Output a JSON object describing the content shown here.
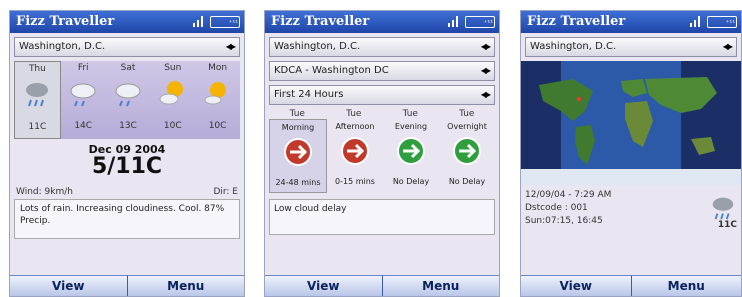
{
  "app": {
    "title": "Fizz Traveller",
    "battery": "⁺¹¹"
  },
  "softkeys": {
    "left": "View",
    "right": "Menu"
  },
  "panel1": {
    "city": "Washington, D.C.",
    "days": [
      {
        "name": "Thu",
        "temp": "11C",
        "icon": "rain-cloud-icon"
      },
      {
        "name": "Fri",
        "temp": "14C",
        "icon": "cloud-icon"
      },
      {
        "name": "Sat",
        "temp": "13C",
        "icon": "cloud-icon"
      },
      {
        "name": "Sun",
        "temp": "10C",
        "icon": "sun-icon"
      },
      {
        "name": "Mon",
        "temp": "10C",
        "icon": "sun-icon"
      }
    ],
    "date": "Dec 09 2004",
    "temp_range": "5/11C",
    "wind": "Wind: 9km/h",
    "direction": "Dir: E",
    "forecast": "Lots of rain. Increasing cloudiness. Cool. 87% Precip."
  },
  "panel2": {
    "city": "Washington, D.C.",
    "airport": "KDCA - Washington DC",
    "period": "First 24 Hours",
    "delays": [
      {
        "day": "Tue",
        "period": "Morning",
        "status": "24-48 mins",
        "color": "#c0392b"
      },
      {
        "day": "Tue",
        "period": "Afternoon",
        "status": "0-15 mins",
        "color": "#c0392b"
      },
      {
        "day": "Tue",
        "period": "Evening",
        "status": "No Delay",
        "color": "#2e9e3e"
      },
      {
        "day": "Tue",
        "period": "Overnight",
        "status": "No Delay",
        "color": "#2e9e3e"
      }
    ],
    "note": "Low cloud delay"
  },
  "panel3": {
    "city": "Washington, D.C.",
    "datetime": "12/09/04 - 7:29 AM",
    "dstcode": "Dstcode : 001",
    "sun": "Sun:07:15, 16:45",
    "temp": "11C"
  }
}
